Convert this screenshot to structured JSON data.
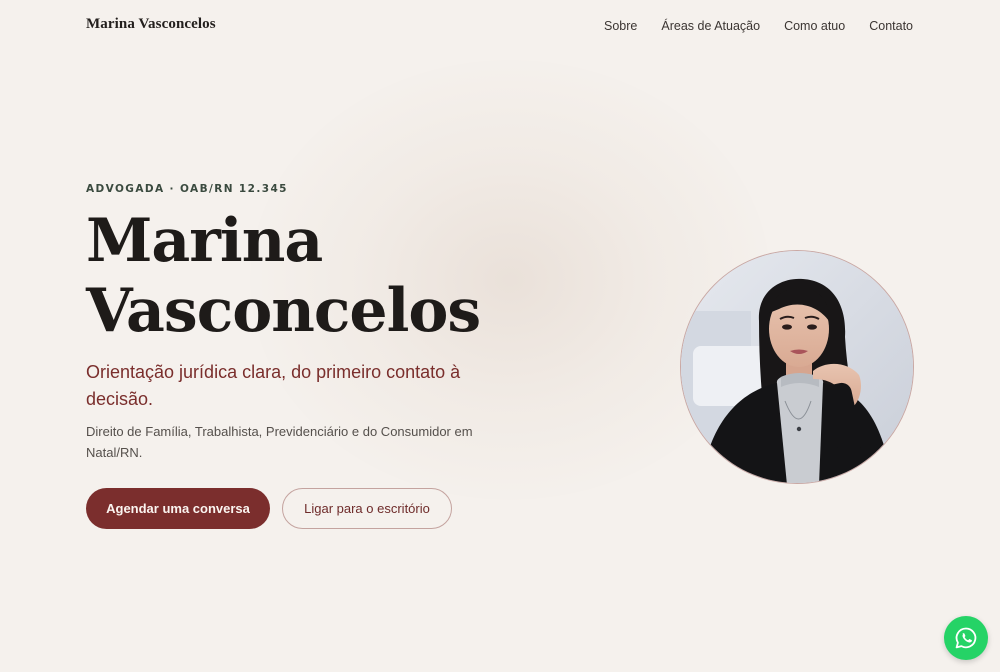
{
  "header": {
    "brand": "Marina Vasconcelos",
    "nav": {
      "about": "Sobre",
      "practice_areas": "Áreas de Atuação",
      "how_i_work": "Como atuo",
      "contact": "Contato"
    }
  },
  "hero": {
    "eyebrow": "ADVOGADA · OAB/RN 12.345",
    "title_line1": "Marina",
    "title_line2": "Vasconcelos",
    "subtitle": "Orientação jurídica clara, do primeiro contato à decisão.",
    "description": "Direito de Família, Trabalhista, Previdenciário e do Consumidor em Natal/RN.",
    "primary_button": "Agendar uma conversa",
    "secondary_button": "Ligar para o escritório"
  },
  "colors": {
    "background": "#f5f1ed",
    "accent": "#7b2e2d",
    "whatsapp": "#25d366"
  },
  "icons": {
    "whatsapp": "whatsapp-icon"
  }
}
